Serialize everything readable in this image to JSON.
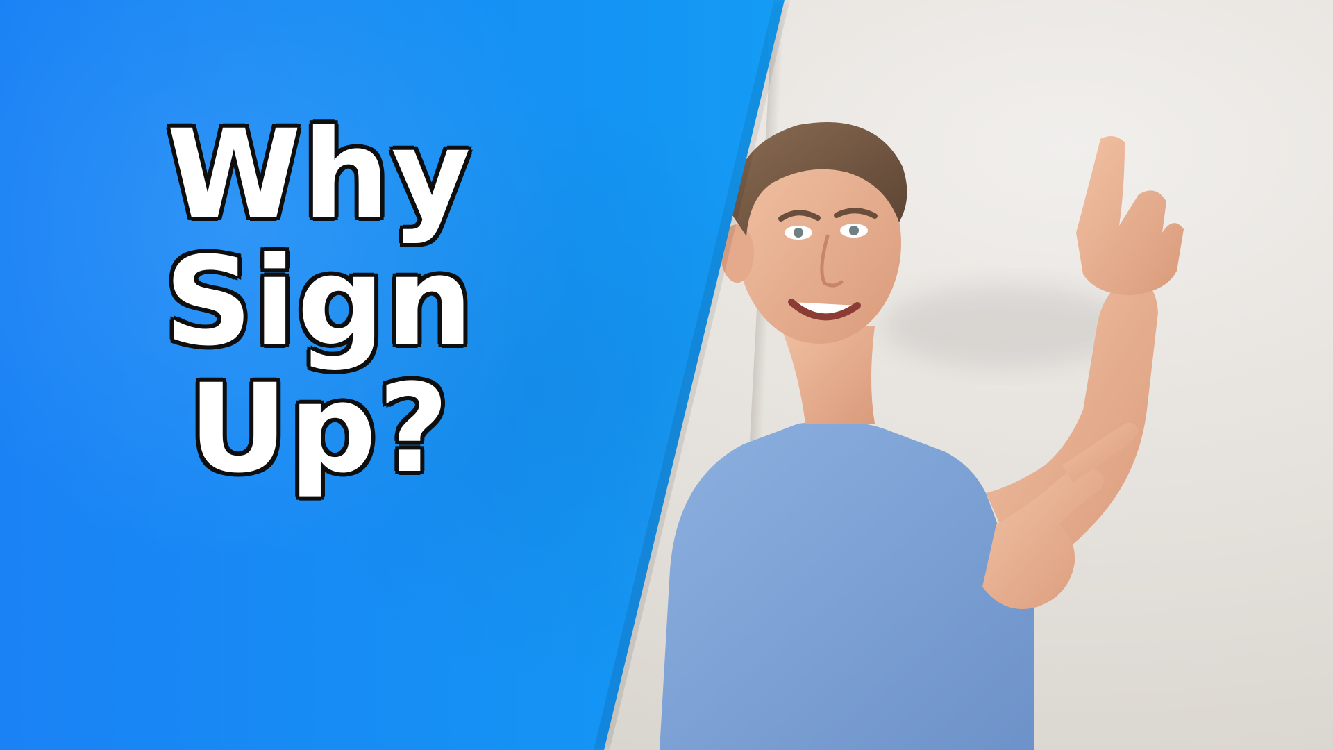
{
  "headline": {
    "line1": "Why",
    "line2": "Sign",
    "line3": "Up?"
  },
  "colors": {
    "panel_blue": "#1495f4",
    "panel_blue_light": "#1bb4f8",
    "text_fill": "#ffffff",
    "text_outline": "#0e0e0e",
    "wall": "#e6e2dd",
    "shirt": "#7fa6d9"
  }
}
